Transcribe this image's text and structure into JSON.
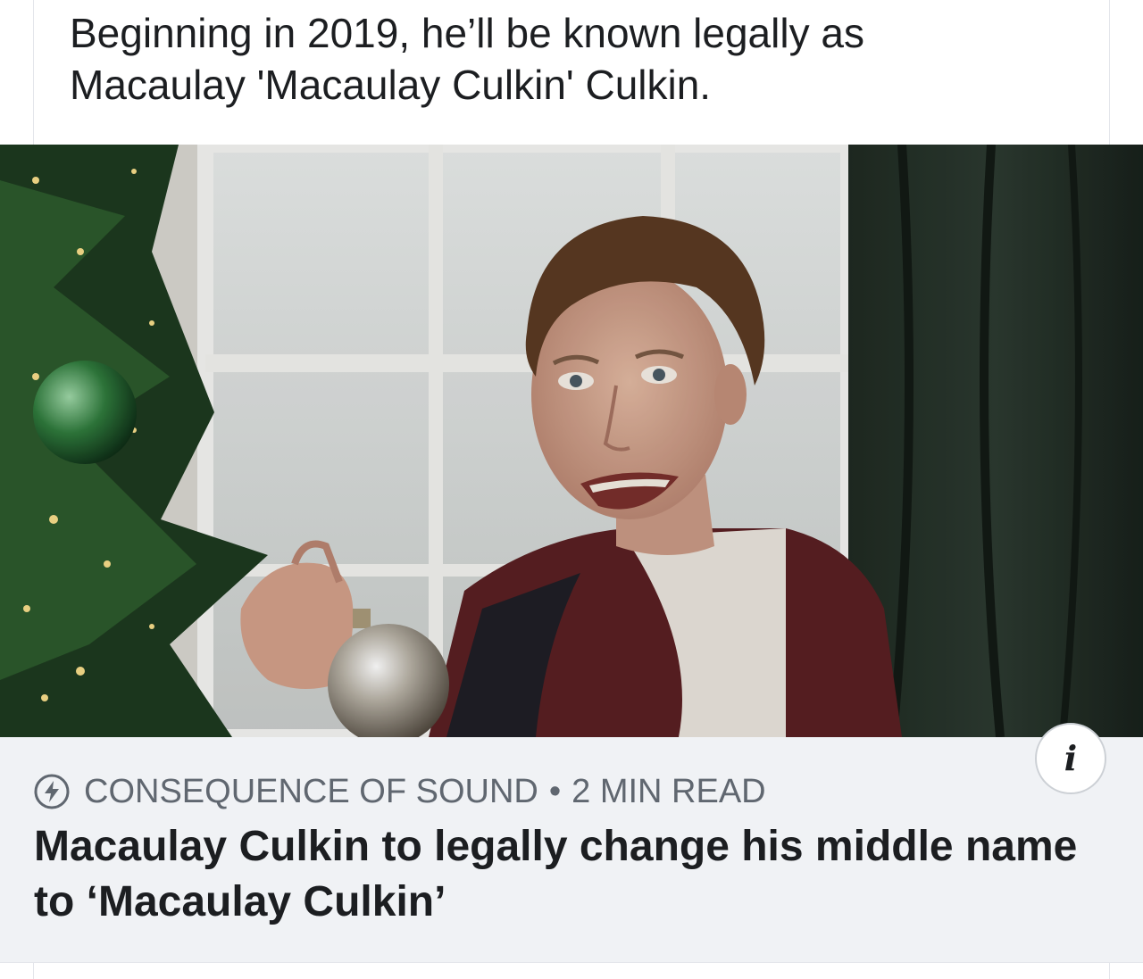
{
  "post": {
    "text_line1": "Beginning in 2019, he’ll be known legally as",
    "text_line2": "Macaulay 'Macaulay Culkin' Culkin."
  },
  "link_preview": {
    "image_description_icon": "photo",
    "info_icon": "info-icon",
    "info_glyph": "i",
    "source": "CONSEQUENCE OF SOUND",
    "separator": "•",
    "read_time": "2 MIN READ",
    "source_icon": "amp-lightning-icon",
    "headline": "Macaulay Culkin to legally change his middle name to ‘Macaulay Culkin’"
  },
  "colors": {
    "text_primary": "#1c1e21",
    "text_secondary": "#606770",
    "card_background": "#f0f2f5",
    "divider": "#e4e6eb"
  }
}
